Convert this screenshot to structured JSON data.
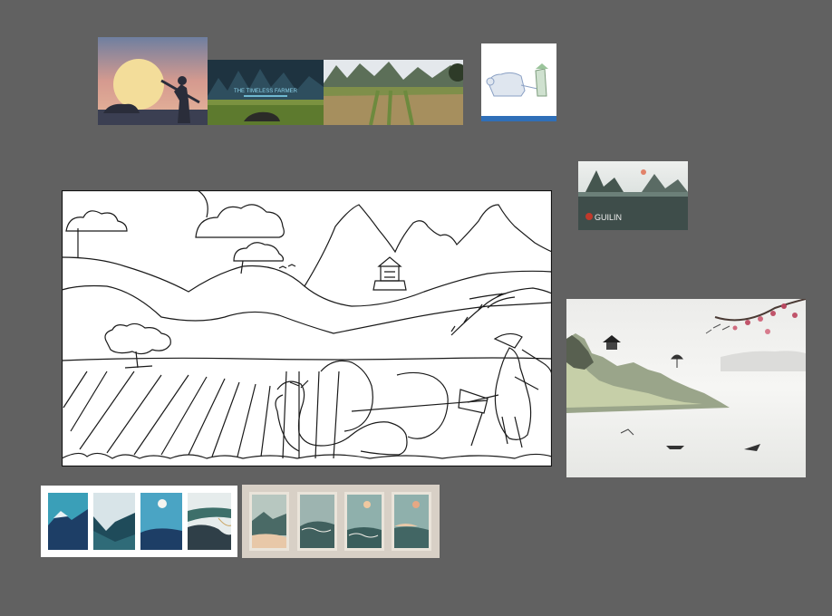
{
  "canvas": {
    "background_color": "#616161",
    "items": [
      {
        "id": "sunset-farmer",
        "type": "image"
      },
      {
        "id": "karst-poster",
        "type": "image",
        "caption": "THE TIMELESS FARMER"
      },
      {
        "id": "rice-field-photo",
        "type": "image"
      },
      {
        "id": "ox-plow-sketch",
        "type": "image"
      },
      {
        "id": "guilin-poster",
        "type": "image",
        "caption": "GUILIN"
      },
      {
        "id": "main-line-drawing",
        "type": "image"
      },
      {
        "id": "misty-landscape",
        "type": "image"
      },
      {
        "id": "teal-posters",
        "type": "image"
      },
      {
        "id": "sea-posters",
        "type": "image"
      }
    ]
  }
}
